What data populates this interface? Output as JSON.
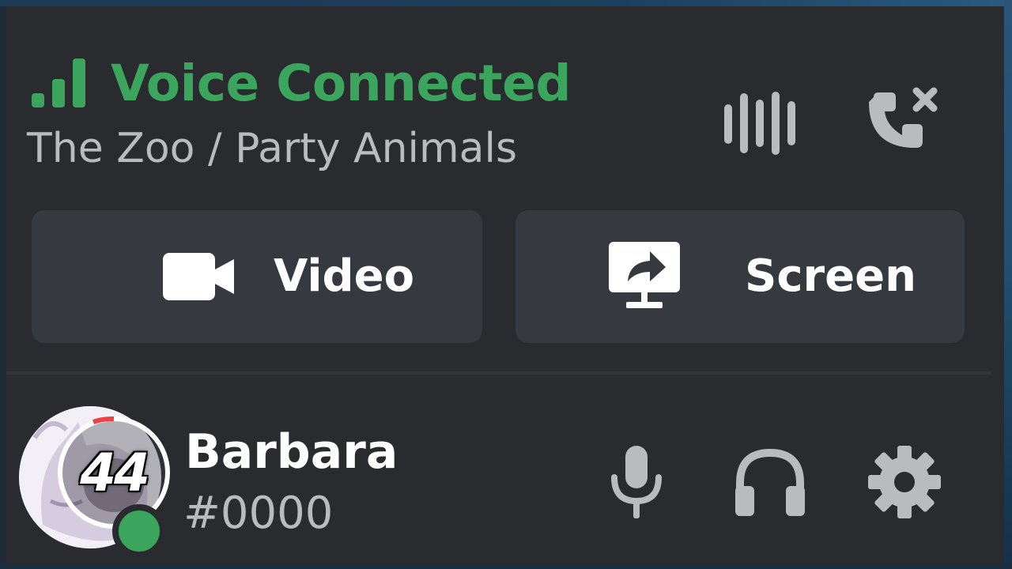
{
  "voice": {
    "status": "Voice Connected",
    "channel_path": "The Zoo / Party Animals"
  },
  "actions": {
    "video_label": "Video",
    "screen_label": "Screen"
  },
  "user": {
    "name": "Barbara",
    "discriminator": "#0000",
    "level": "44",
    "presence": "online"
  },
  "icons": {
    "signal": "signal-bars-icon",
    "soundboard": "soundboard-icon",
    "disconnect": "phone-disconnect-icon",
    "video": "video-camera-icon",
    "screen": "screen-share-icon",
    "mic": "microphone-icon",
    "headset": "headphones-icon",
    "settings": "gear-icon"
  },
  "colors": {
    "connected_green": "#3ba55d",
    "panel_bg": "#292b2f",
    "button_bg": "#36393f",
    "muted_text": "#b9bbbe",
    "icon_gray": "#b9bbbe"
  }
}
